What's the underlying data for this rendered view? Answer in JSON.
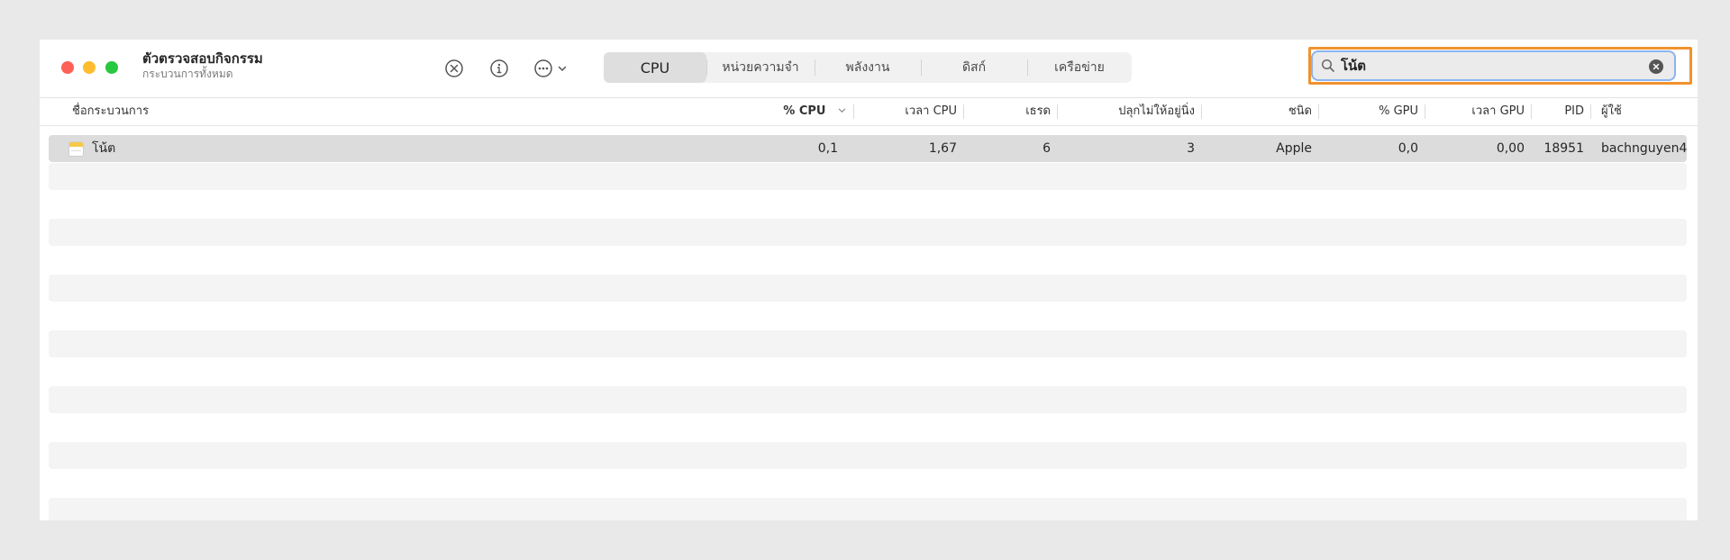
{
  "window": {
    "title": "ตัวตรวจสอบกิจกรรม",
    "subtitle": "กระบวนการทั้งหมด"
  },
  "toolbar": {
    "stop_icon": "x-circle-icon",
    "info_icon": "info-icon",
    "more_icon": "ellipsis-circle-icon",
    "more_chevron": "chevron-down-icon"
  },
  "tabs": [
    {
      "label": "CPU",
      "active": true
    },
    {
      "label": "หน่วยความจำ",
      "active": false
    },
    {
      "label": "พลังงาน",
      "active": false
    },
    {
      "label": "ดิสก์",
      "active": false
    },
    {
      "label": "เครือข่าย",
      "active": false
    }
  ],
  "search": {
    "value": "โน้ต",
    "icon": "search-icon",
    "clear_icon": "clear-icon"
  },
  "columns": {
    "name": "ชื่อกระบวนการ",
    "cpu_percent": "% CPU",
    "cpu_time": "เวลา CPU",
    "threads": "เธรด",
    "idle_wake": "ปลุกไม่ให้อยู่นิ่ง",
    "kind": "ชนิด",
    "gpu_percent": "% GPU",
    "gpu_time": "เวลา GPU",
    "pid": "PID",
    "user": "ผู้ใช้"
  },
  "rows": [
    {
      "name": "โน้ต",
      "icon": "notes-app-icon",
      "cpu_percent": "0,1",
      "cpu_time": "1,67",
      "threads": "6",
      "idle_wake": "3",
      "kind": "Apple",
      "gpu_percent": "0,0",
      "gpu_time": "0,00",
      "pid": "18951",
      "user": "bachnguyen4"
    }
  ],
  "colors": {
    "highlight_outline": "#f0922e",
    "search_focus": "#8ab4f2",
    "selected_row": "#dcdcdc"
  }
}
